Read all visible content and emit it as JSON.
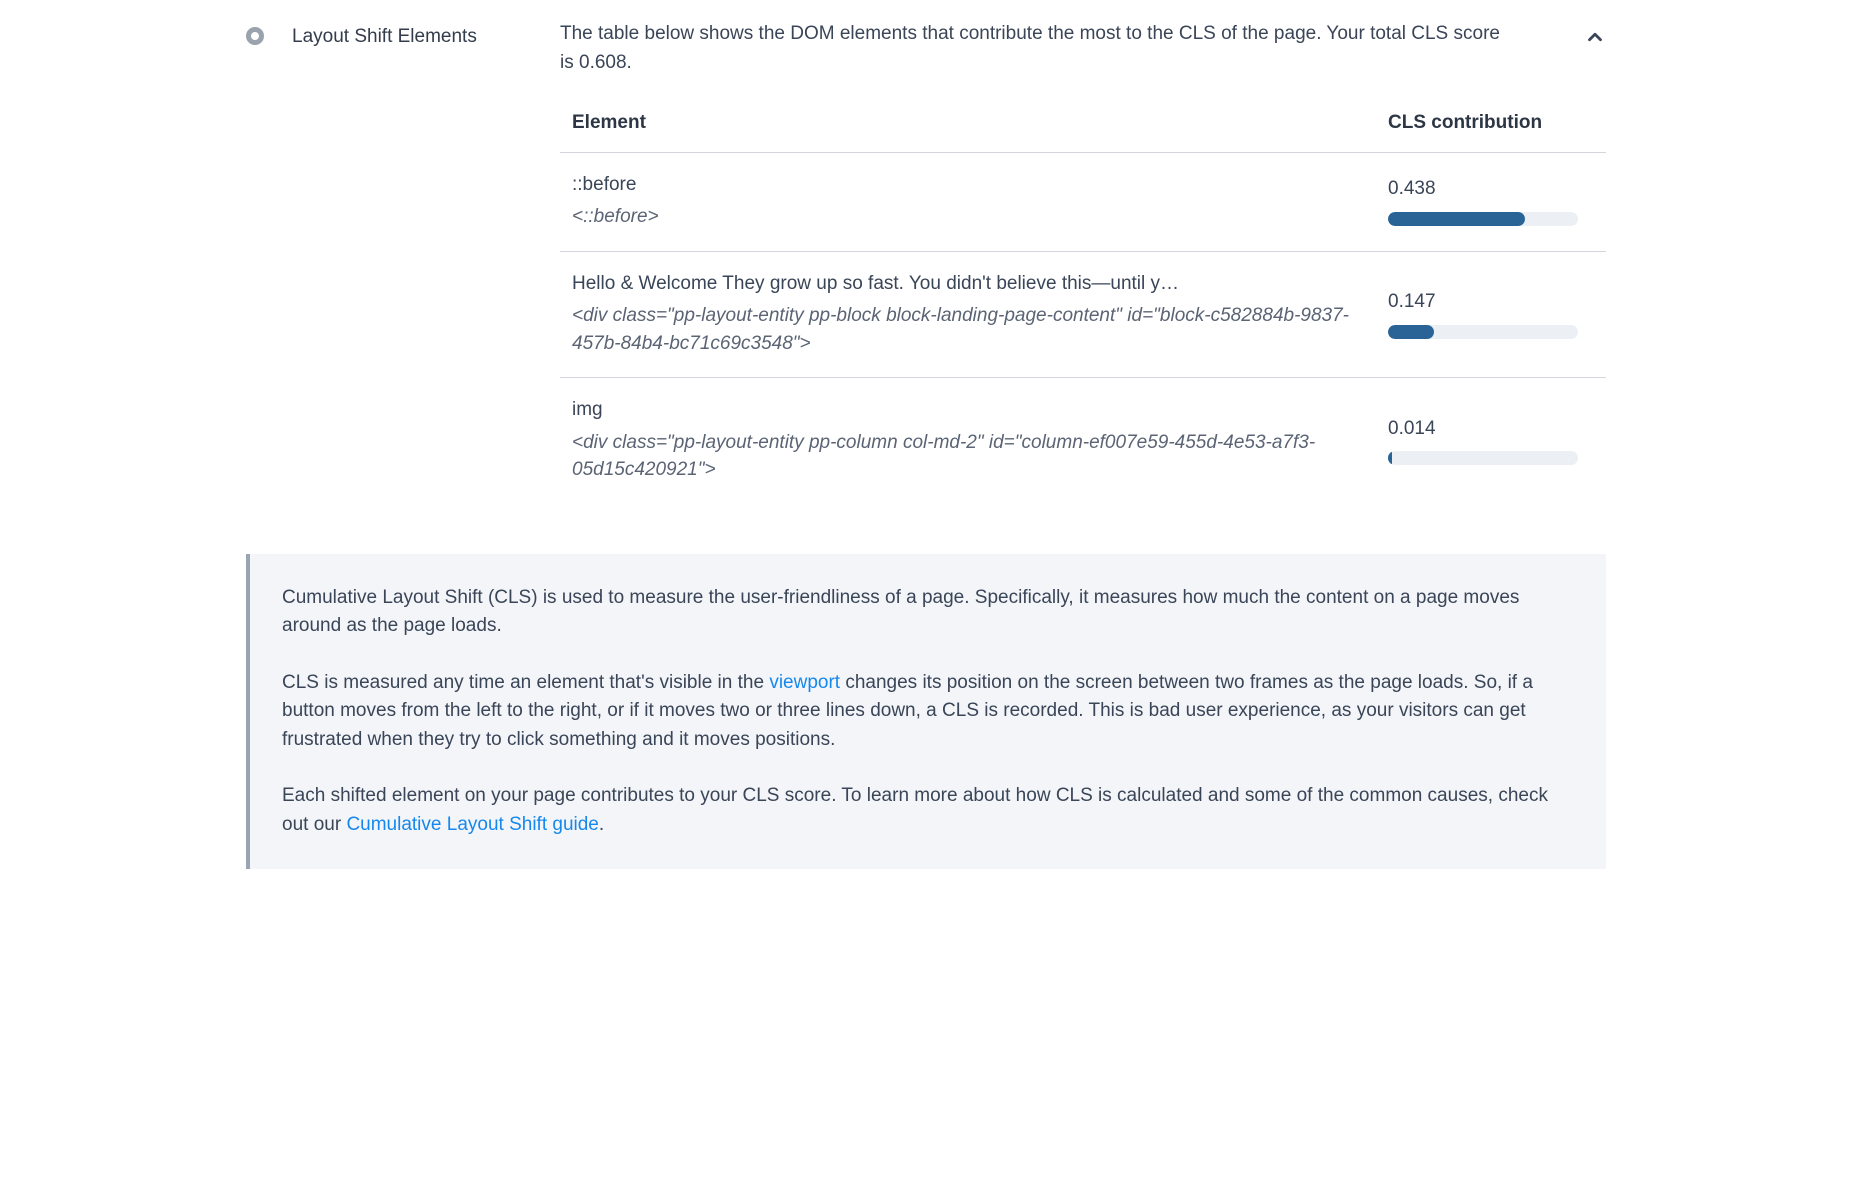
{
  "section": {
    "title": "Layout Shift Elements",
    "description": "The table below shows the DOM elements that contribute the most to the CLS of the page. Your total CLS score is 0.608."
  },
  "table": {
    "headers": {
      "element": "Element",
      "cls": "CLS contribution"
    },
    "max_value": 0.608,
    "rows": [
      {
        "name": "::before",
        "html": "<::before>",
        "value": "0.438",
        "pct": 72
      },
      {
        "name": "Hello & Welcome They grow up so fast. You didn't believe this—until y…",
        "html": "<div class=\"pp-layout-entity pp-block block-landing-page-content\" id=\"block-c582884b-9837-457b-84b4-bc71c69c3548\">",
        "value": "0.147",
        "pct": 24
      },
      {
        "name": "img",
        "html": "<div class=\"pp-layout-entity pp-column col-md-2\" id=\"column-ef007e59-455d-4e53-a7f3-05d15c420921\">",
        "value": "0.014",
        "pct": 2.3
      }
    ]
  },
  "info": {
    "p1": "Cumulative Layout Shift (CLS) is used to measure the user-friendliness of a page. Specifically, it measures how much the content on a page moves around as the page loads.",
    "p2a": "CLS is measured any time an element that's visible in the ",
    "p2_link1": "viewport",
    "p2b": " changes its position on the screen between two frames as the page loads. So, if a button moves from the left to the right, or if it moves two or three lines down, a CLS is recorded. This is bad user experience, as your visitors can get frustrated when they try to click something and it moves positions.",
    "p3a": "Each shifted element on your page contributes to your CLS score. To learn more about how CLS is calculated and some of the common causes, check out our ",
    "p3_link1": "Cumulative Layout Shift guide",
    "p3b": "."
  }
}
